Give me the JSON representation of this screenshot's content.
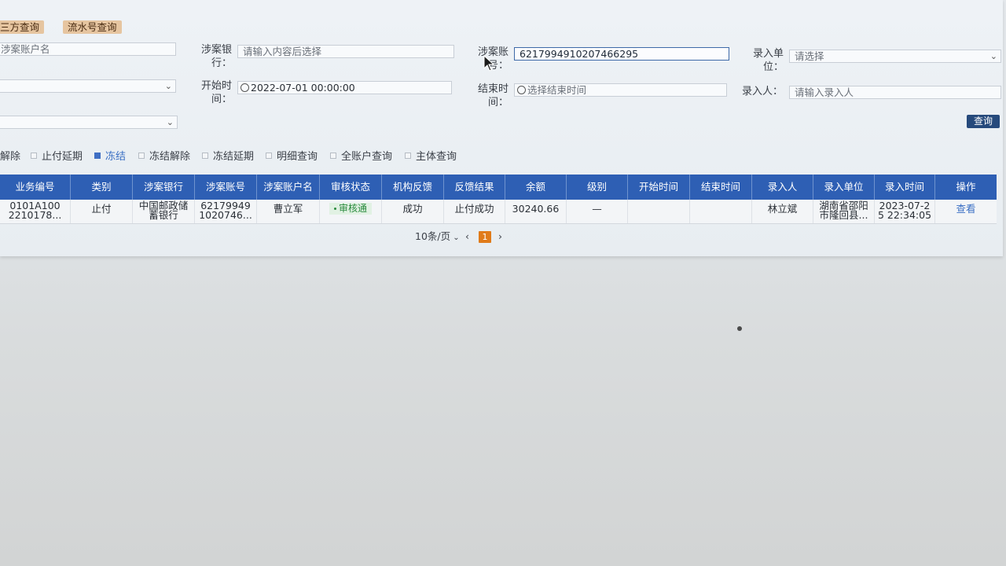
{
  "tabs": {
    "third_party": "三方查询",
    "serial": "流水号查询"
  },
  "form": {
    "account_name_label": "涉案账户名",
    "bank_label_1": "涉案银",
    "bank_label_2": "行：",
    "bank_placeholder": "请输入内容后选择",
    "account_no_label_1": "涉案账",
    "account_no_label_2": "号：",
    "account_no_value": "6217994910207466295",
    "unit_label_1": "录入单",
    "unit_label_2": "位：",
    "unit_placeholder": "请选择",
    "start_label_1": "开始时",
    "start_label_2": "间：",
    "start_value": "2022-07-01 00:00:00",
    "end_label_1": "结束时",
    "end_label_2": "间：",
    "end_placeholder": "选择结束时间",
    "entrant_label": "录入人：",
    "entrant_placeholder": "请输入录入人",
    "query_button": "查询"
  },
  "filters": [
    {
      "label": "解除",
      "checked": false
    },
    {
      "label": "止付延期",
      "checked": false
    },
    {
      "label": "冻结",
      "checked": true
    },
    {
      "label": "冻结解除",
      "checked": false
    },
    {
      "label": "冻结延期",
      "checked": false
    },
    {
      "label": "明细查询",
      "checked": false
    },
    {
      "label": "全账户查询",
      "checked": false
    },
    {
      "label": "主体查询",
      "checked": false
    }
  ],
  "table": {
    "headers": [
      "业务编号",
      "类别",
      "涉案银行",
      "涉案账号",
      "涉案账户名",
      "审核状态",
      "机构反馈",
      "反馈结果",
      "余额",
      "级别",
      "开始时间",
      "结束时间",
      "录入人",
      "录入单位",
      "录入时间",
      "操作"
    ],
    "row": {
      "biz_no_1": "0101A100",
      "biz_no_2": "2210178...",
      "category": "止付",
      "bank_1": "中国邮政储",
      "bank_2": "蓄银行",
      "account_1": "62179949",
      "account_2": "1020746...",
      "account_name": "曹立军",
      "audit_status": "审核通",
      "org_feedback": "成功",
      "feedback_result": "止付成功",
      "balance": "30240.66",
      "level": "—",
      "start_time": "",
      "end_time": "",
      "entrant": "林立斌",
      "unit_1": "湖南省邵阳",
      "unit_2": "市隆回县...",
      "entry_time_1": "2023-07-2",
      "entry_time_2": "5 22:34:05",
      "action": "查看"
    }
  },
  "pager": {
    "page_size": "10条/页",
    "prev": "‹",
    "current": "1",
    "next": "›"
  },
  "colors": {
    "header_bg": "#2e5fb4",
    "query_btn": "#264a7c",
    "tab_bg": "#e6c5a0",
    "page_active": "#e07b1a"
  }
}
